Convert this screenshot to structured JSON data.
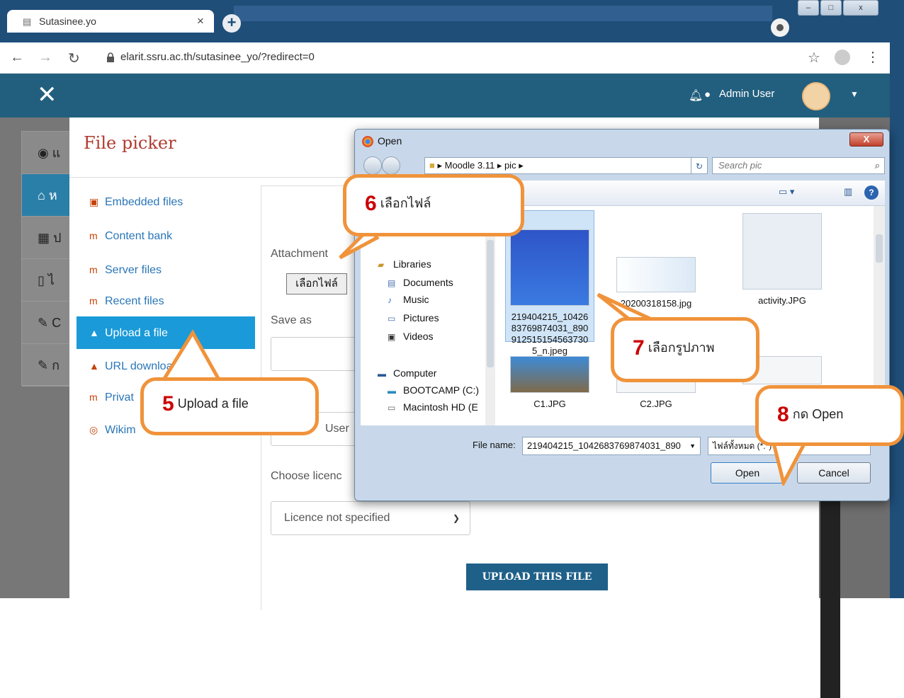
{
  "browser": {
    "tab_title": "Sutasinee.yo",
    "url": "elarit.ssru.ac.th/sutasinee_yo/?redirect=0"
  },
  "moodle_header": {
    "user_name": "Admin User"
  },
  "left_nav": {
    "items": [
      "แ",
      "ห",
      "ป",
      "ไ",
      "C",
      "ก"
    ]
  },
  "file_picker": {
    "title": "File picker",
    "repositories": [
      {
        "label": "Embedded files",
        "icon": "file-icon"
      },
      {
        "label": "Content bank",
        "icon": "moodle-icon"
      },
      {
        "label": "Server files",
        "icon": "moodle-icon"
      },
      {
        "label": "Recent files",
        "icon": "moodle-icon"
      },
      {
        "label": "Upload a file",
        "icon": "upload-icon",
        "active": true
      },
      {
        "label": "URL downloa",
        "icon": "url-icon"
      },
      {
        "label": "Privat",
        "icon": "moodle-icon"
      },
      {
        "label": "Wikim",
        "icon": "wikimedia-icon"
      }
    ],
    "attachment_label": "Attachment",
    "choose_file_button": "เลือกไฟล์",
    "save_as_label": "Save as",
    "author_value": "User",
    "licence_label": "Choose licenc",
    "licence_value": "Licence not specified",
    "upload_button": "UPLOAD THIS FILE"
  },
  "open_dialog": {
    "title": "Open",
    "close_label": "X",
    "breadcrumb": [
      "Moodle 3.11",
      "pic"
    ],
    "search_placeholder": "Search pic",
    "nav_tree": [
      "Libraries",
      "Documents",
      "Music",
      "Pictures",
      "Videos",
      "Computer",
      "BOOTCAMP (C:)",
      "Macintosh HD (E"
    ],
    "files": [
      {
        "name": "219404215_10426\n83769874031_890\n912515154563730\n5_n.jpeg",
        "selected": true
      },
      {
        "name": "20200318158.jpg"
      },
      {
        "name": "activity.JPG"
      },
      {
        "name": "C1.JPG"
      },
      {
        "name": "C2.JPG"
      },
      {
        "name": ""
      }
    ],
    "file_name_label": "File name:",
    "file_name_value": "219404215_1042683769874031_890",
    "file_type_value": "ไฟล์ทั้งหมด (*.*)",
    "open_button": "Open",
    "cancel_button": "Cancel"
  },
  "callouts": [
    {
      "num": "5",
      "text": "Upload a file"
    },
    {
      "num": "6",
      "text": "เลือกไฟล์"
    },
    {
      "num": "7",
      "text": "เลือกรูปภาพ"
    },
    {
      "num": "8",
      "text": "กด Open"
    }
  ],
  "colors": {
    "accent": "#f0933b",
    "moodle_header": "#225f7e",
    "active_repo": "#1a9ad8",
    "title_red": "#b13a2e"
  }
}
